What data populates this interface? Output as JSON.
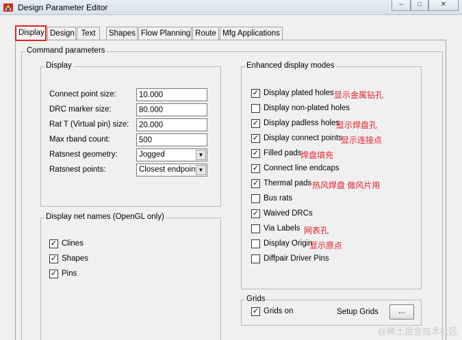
{
  "window": {
    "title": "Design Parameter Editor",
    "buttons": [
      "–",
      "□",
      "✕"
    ]
  },
  "tabs": [
    {
      "label": "Display",
      "active": true
    },
    {
      "label": "Design"
    },
    {
      "label": "Text"
    },
    {
      "label": "Shapes"
    },
    {
      "label": "Flow Planning"
    },
    {
      "label": "Route"
    },
    {
      "label": "Mfg Applications"
    }
  ],
  "command_parameters": {
    "title": "Command parameters",
    "display": {
      "title": "Display",
      "fields": [
        {
          "label": "Connect point size:",
          "value": "10.000"
        },
        {
          "label": "DRC marker size:",
          "value": "80.000"
        },
        {
          "label": "Rat T (Virtual pin) size:",
          "value": "20.000"
        },
        {
          "label": "Max rband count:",
          "value": "500"
        }
      ],
      "ratsnest_geometry": {
        "label": "Ratsnest geometry:",
        "value": "Jogged"
      },
      "ratsnest_points": {
        "label": "Ratsnest points:",
        "value": "Closest endpoint"
      }
    },
    "net_names": {
      "title": "Display net names (OpenGL only)",
      "items": [
        {
          "label": "Clines",
          "checked": true
        },
        {
          "label": "Shapes",
          "checked": true
        },
        {
          "label": "Pins",
          "checked": true
        }
      ]
    },
    "enhanced": {
      "title": "Enhanced display modes",
      "items": [
        {
          "label": "Display plated holes",
          "checked": true,
          "note": "显示金属钻孔"
        },
        {
          "label": "Display non-plated holes",
          "checked": false,
          "note": ""
        },
        {
          "label": "Display padless holes",
          "checked": true,
          "note": "显示焊盘孔"
        },
        {
          "label": "Display connect points",
          "checked": true,
          "note": "显示连接点"
        },
        {
          "label": "Filled pads",
          "checked": true,
          "note": "焊盘填充"
        },
        {
          "label": "Connect line endcaps",
          "checked": true,
          "note": ""
        },
        {
          "label": "Thermal pads",
          "checked": true,
          "note": "热风焊盘 做风片用"
        },
        {
          "label": "Bus rats",
          "checked": false,
          "note": ""
        },
        {
          "label": "Waived DRCs",
          "checked": true,
          "note": ""
        },
        {
          "label": "Via Labels",
          "checked": false,
          "note": "网表孔"
        },
        {
          "label": "Display Origin",
          "checked": false,
          "note": "显示原点"
        },
        {
          "label": "Diffpair Driver Pins",
          "checked": false,
          "note": ""
        }
      ]
    },
    "grids": {
      "title": "Grids",
      "grids_on": {
        "label": "Grids on",
        "checked": true
      },
      "setup_label": "Setup Grids",
      "setup_button": "..."
    }
  },
  "watermark": "@稀土掘金技术社区",
  "colors": {
    "accent_red": "#e8202a",
    "tab_highlight": "#e02020"
  }
}
